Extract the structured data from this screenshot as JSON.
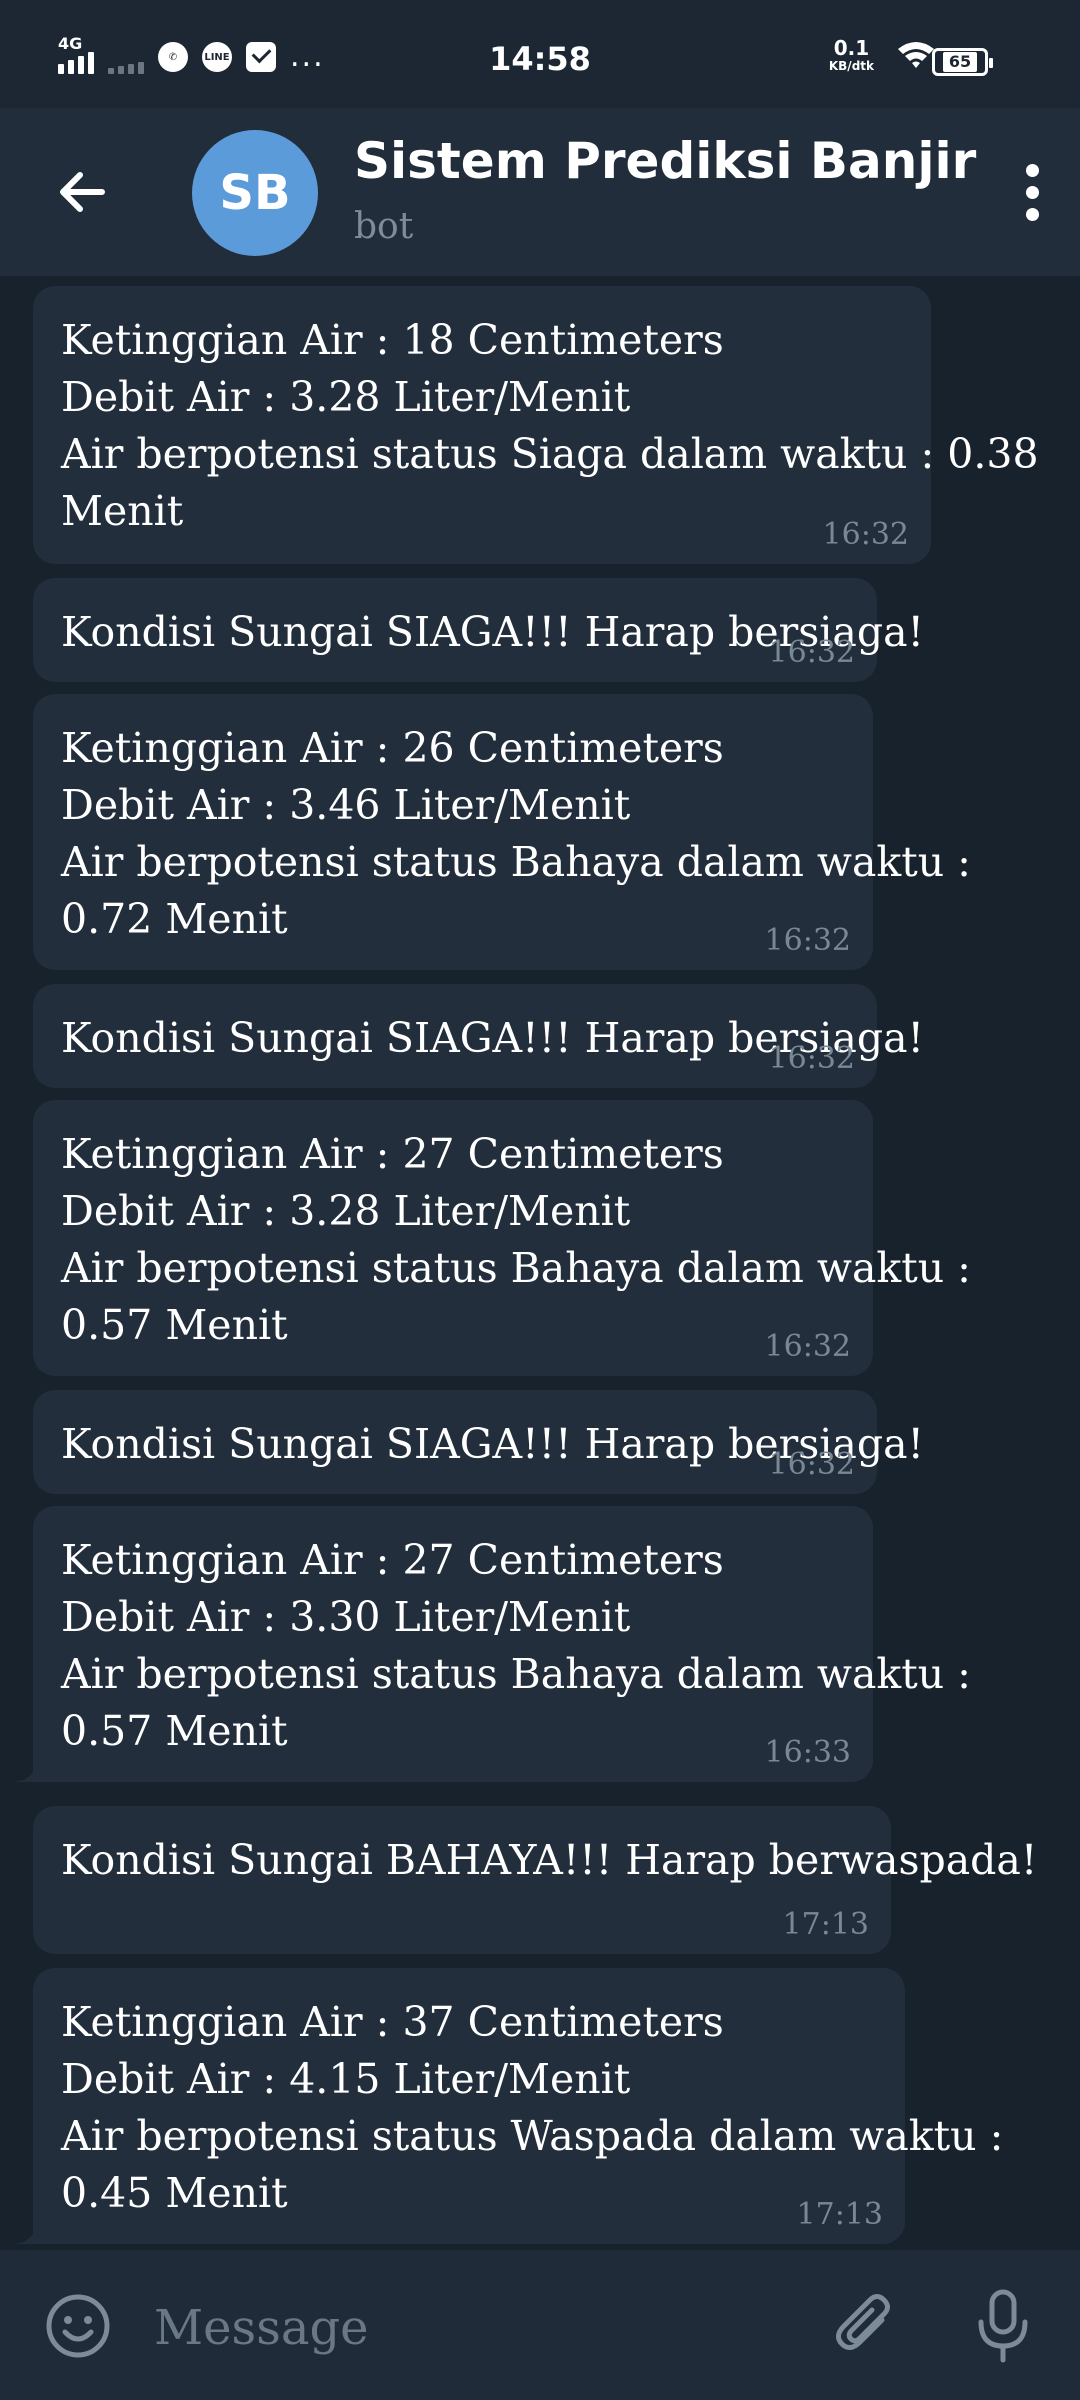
{
  "status_bar": {
    "network": "4G",
    "time": "14:58",
    "speed_value": "0.1",
    "speed_unit": "KB/dtk",
    "battery": "65",
    "line_label": "LINE",
    "more": "..."
  },
  "header": {
    "avatar_initials": "SB",
    "title": "Sistem Prediksi Banjir",
    "subtitle": "bot"
  },
  "messages": [
    {
      "lines": [
        "Ketinggian Air : 18 Centimeters",
        "Debit Air : 3.28 Liter/Menit",
        "Air berpotensi status Siaga dalam waktu : 0.38",
        "Menit"
      ],
      "time": "16:32"
    },
    {
      "lines": [
        "Kondisi Sungai SIAGA!!! Harap bersiaga!"
      ],
      "time": "16:32"
    },
    {
      "lines": [
        "Ketinggian Air : 26 Centimeters",
        "Debit Air : 3.46 Liter/Menit",
        "Air berpotensi status Bahaya dalam waktu :",
        "0.72 Menit"
      ],
      "time": "16:32"
    },
    {
      "lines": [
        "Kondisi Sungai SIAGA!!! Harap bersiaga!"
      ],
      "time": "16:32"
    },
    {
      "lines": [
        "Ketinggian Air : 27 Centimeters",
        "Debit Air : 3.28 Liter/Menit",
        "Air berpotensi status Bahaya dalam waktu :",
        "0.57 Menit"
      ],
      "time": "16:32"
    },
    {
      "lines": [
        "Kondisi Sungai SIAGA!!! Harap bersiaga!"
      ],
      "time": "16:32"
    },
    {
      "lines": [
        "Ketinggian Air : 27 Centimeters",
        "Debit Air : 3.30 Liter/Menit",
        "Air berpotensi status Bahaya dalam waktu :",
        "0.57 Menit"
      ],
      "time": "16:33"
    },
    {
      "lines": [
        "Kondisi Sungai BAHAYA!!! Harap berwaspada!"
      ],
      "time": "17:13"
    },
    {
      "lines": [
        "Ketinggian Air : 37 Centimeters",
        "Debit Air : 4.15 Liter/Menit",
        "Air berpotensi status Waspada dalam waktu :",
        "0.45 Menit"
      ],
      "time": "17:13"
    }
  ],
  "input": {
    "placeholder": "Message"
  },
  "icons": {
    "back": "arrow-left-icon",
    "menu": "more-vertical-icon",
    "emoji": "smile-icon",
    "attach": "paperclip-icon",
    "mic": "microphone-icon"
  },
  "colors": {
    "background": "#18222d",
    "header": "#212d3b",
    "bubble": "#222e3b",
    "avatar": "#5b9bd9",
    "timestamp": "#7a8896"
  }
}
